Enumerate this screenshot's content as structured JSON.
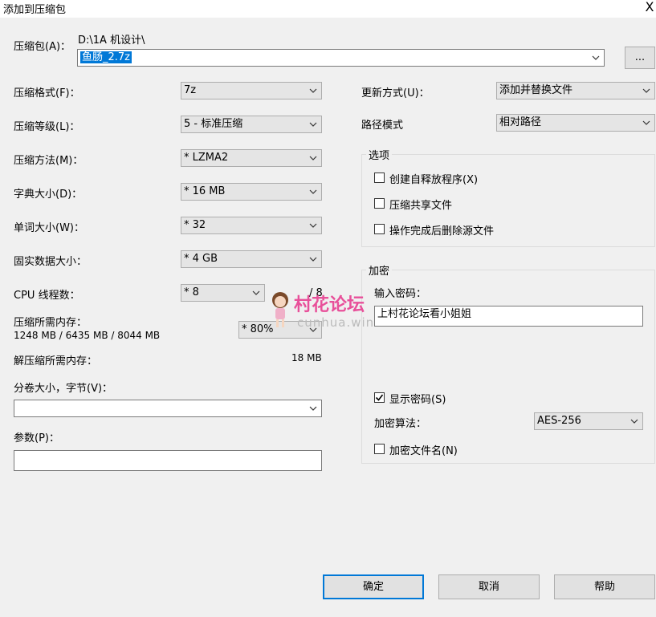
{
  "window": {
    "title": "添加到压缩包",
    "close_glyph": "X"
  },
  "archive": {
    "label": "压缩包(A)：",
    "path": "D:\\1A 机设计\\",
    "filename": "鱼肠_2.7z",
    "browse_label": "..."
  },
  "left": {
    "format": {
      "label": "压缩格式(F)：",
      "value": "7z"
    },
    "level": {
      "label": "压缩等级(L)：",
      "value": "5 - 标准压缩"
    },
    "method": {
      "label": "压缩方法(M)：",
      "value": "* LZMA2"
    },
    "dict": {
      "label": "字典大小(D)：",
      "value": "* 16 MB"
    },
    "word": {
      "label": "单词大小(W)：",
      "value": "* 32"
    },
    "solid": {
      "label": "固实数据大小：",
      "value": "* 4 GB"
    },
    "threads": {
      "label": "CPU 线程数：",
      "value": "* 8",
      "max": "/ 8"
    },
    "memory": {
      "label": "压缩所需内存：",
      "detail": "1248 MB / 6435 MB / 8044 MB",
      "percent": "* 80%"
    },
    "decompress": {
      "label": "解压缩所需内存：",
      "value": "18 MB"
    },
    "volume": {
      "label": "分卷大小，字节(V)：",
      "value": ""
    },
    "params": {
      "label": "参数(P)：",
      "value": ""
    }
  },
  "right": {
    "update": {
      "label": "更新方式(U)：",
      "value": "添加并替换文件"
    },
    "path_mode": {
      "label": "路径模式",
      "value": "相对路径"
    },
    "options": {
      "title": "选项",
      "items": [
        {
          "label": "创建自释放程序(X)",
          "checked": false
        },
        {
          "label": "压缩共享文件",
          "checked": false
        },
        {
          "label": "操作完成后删除源文件",
          "checked": false
        }
      ]
    },
    "encryption": {
      "title": "加密",
      "password_label": "输入密码：",
      "password_value": "上村花论坛看小姐姐",
      "show_password": {
        "label": "显示密码(S)",
        "checked": true
      },
      "method_label": "加密算法：",
      "method_value": "AES-256",
      "encrypt_names": {
        "label": "加密文件名(N)",
        "checked": false
      }
    }
  },
  "buttons": {
    "ok": "确定",
    "cancel": "取消",
    "help": "帮助"
  },
  "watermark": {
    "text": "村花论坛",
    "sub": "cunhua.win"
  },
  "colors": {
    "accent": "#0078d7",
    "background": "#f0f0f0",
    "watermark": "#e8509a"
  }
}
